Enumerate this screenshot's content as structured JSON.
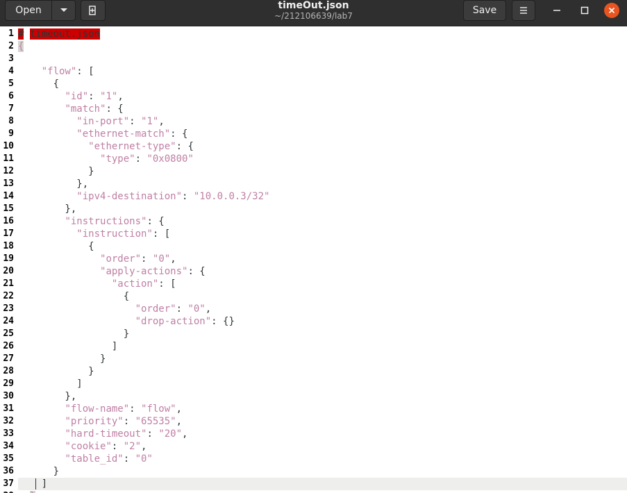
{
  "header": {
    "open_label": "Open",
    "title": "timeOut.json",
    "subtitle": "~/212106639/lab7",
    "save_label": "Save",
    "icons": {
      "open_menu": "chevron-down-icon",
      "new_tab": "new-document-icon",
      "menu": "hamburger-menu-icon",
      "minimize": "minimize-icon",
      "maximize": "maximize-icon",
      "close": "close-icon"
    },
    "colors": {
      "headerbar": "#2f2f2f",
      "close_button": "#e95420"
    }
  },
  "editor": {
    "current_line": 37,
    "colors": {
      "string": "#bf7fa4",
      "error_highlight": "#cc0000",
      "current_line_bg": "#eeeeec"
    },
    "lines": [
      [
        {
          "t": "#",
          "c": "err"
        },
        {
          "t": " ",
          "c": "punc"
        },
        {
          "t": "timeout.json",
          "c": "err"
        }
      ],
      [
        {
          "t": "{",
          "c": "box"
        }
      ],
      [],
      [
        {
          "t": "    ",
          "c": "punc"
        },
        {
          "t": "\"flow\"",
          "c": "str"
        },
        {
          "t": ": [",
          "c": "punc"
        }
      ],
      [
        {
          "t": "      {",
          "c": "punc"
        }
      ],
      [
        {
          "t": "        ",
          "c": "punc"
        },
        {
          "t": "\"id\"",
          "c": "str"
        },
        {
          "t": ": ",
          "c": "punc"
        },
        {
          "t": "\"1\"",
          "c": "str"
        },
        {
          "t": ",",
          "c": "punc"
        }
      ],
      [
        {
          "t": "        ",
          "c": "punc"
        },
        {
          "t": "\"match\"",
          "c": "str"
        },
        {
          "t": ": {",
          "c": "punc"
        }
      ],
      [
        {
          "t": "          ",
          "c": "punc"
        },
        {
          "t": "\"in-port\"",
          "c": "str"
        },
        {
          "t": ": ",
          "c": "punc"
        },
        {
          "t": "\"1\"",
          "c": "str"
        },
        {
          "t": ",",
          "c": "punc"
        }
      ],
      [
        {
          "t": "          ",
          "c": "punc"
        },
        {
          "t": "\"ethernet-match\"",
          "c": "str"
        },
        {
          "t": ": {",
          "c": "punc"
        }
      ],
      [
        {
          "t": "            ",
          "c": "punc"
        },
        {
          "t": "\"ethernet-type\"",
          "c": "str"
        },
        {
          "t": ": {",
          "c": "punc"
        }
      ],
      [
        {
          "t": "              ",
          "c": "punc"
        },
        {
          "t": "\"type\"",
          "c": "str"
        },
        {
          "t": ": ",
          "c": "punc"
        },
        {
          "t": "\"0x0800\"",
          "c": "str"
        }
      ],
      [
        {
          "t": "            }",
          "c": "punc"
        }
      ],
      [
        {
          "t": "          },",
          "c": "punc"
        }
      ],
      [
        {
          "t": "          ",
          "c": "punc"
        },
        {
          "t": "\"ipv4-destination\"",
          "c": "str"
        },
        {
          "t": ": ",
          "c": "punc"
        },
        {
          "t": "\"10.0.0.3/32\"",
          "c": "str"
        }
      ],
      [
        {
          "t": "        },",
          "c": "punc"
        }
      ],
      [
        {
          "t": "        ",
          "c": "punc"
        },
        {
          "t": "\"instructions\"",
          "c": "str"
        },
        {
          "t": ": {",
          "c": "punc"
        }
      ],
      [
        {
          "t": "          ",
          "c": "punc"
        },
        {
          "t": "\"instruction\"",
          "c": "str"
        },
        {
          "t": ": [",
          "c": "punc"
        }
      ],
      [
        {
          "t": "            {",
          "c": "punc"
        }
      ],
      [
        {
          "t": "              ",
          "c": "punc"
        },
        {
          "t": "\"order\"",
          "c": "str"
        },
        {
          "t": ": ",
          "c": "punc"
        },
        {
          "t": "\"0\"",
          "c": "str"
        },
        {
          "t": ",",
          "c": "punc"
        }
      ],
      [
        {
          "t": "              ",
          "c": "punc"
        },
        {
          "t": "\"apply-actions\"",
          "c": "str"
        },
        {
          "t": ": {",
          "c": "punc"
        }
      ],
      [
        {
          "t": "                ",
          "c": "punc"
        },
        {
          "t": "\"action\"",
          "c": "str"
        },
        {
          "t": ": [",
          "c": "punc"
        }
      ],
      [
        {
          "t": "                  {",
          "c": "punc"
        }
      ],
      [
        {
          "t": "                    ",
          "c": "punc"
        },
        {
          "t": "\"order\"",
          "c": "str"
        },
        {
          "t": ": ",
          "c": "punc"
        },
        {
          "t": "\"0\"",
          "c": "str"
        },
        {
          "t": ",",
          "c": "punc"
        }
      ],
      [
        {
          "t": "                    ",
          "c": "punc"
        },
        {
          "t": "\"drop-action\"",
          "c": "str"
        },
        {
          "t": ": {}",
          "c": "punc"
        }
      ],
      [
        {
          "t": "                  }",
          "c": "punc"
        }
      ],
      [
        {
          "t": "                ]",
          "c": "punc"
        }
      ],
      [
        {
          "t": "              }",
          "c": "punc"
        }
      ],
      [
        {
          "t": "            }",
          "c": "punc"
        }
      ],
      [
        {
          "t": "          ]",
          "c": "punc"
        }
      ],
      [
        {
          "t": "        },",
          "c": "punc"
        }
      ],
      [
        {
          "t": "        ",
          "c": "punc"
        },
        {
          "t": "\"flow-name\"",
          "c": "str"
        },
        {
          "t": ": ",
          "c": "punc"
        },
        {
          "t": "\"flow\"",
          "c": "str"
        },
        {
          "t": ",",
          "c": "punc"
        }
      ],
      [
        {
          "t": "        ",
          "c": "punc"
        },
        {
          "t": "\"priority\"",
          "c": "str"
        },
        {
          "t": ": ",
          "c": "punc"
        },
        {
          "t": "\"65535\"",
          "c": "str"
        },
        {
          "t": ",",
          "c": "punc"
        }
      ],
      [
        {
          "t": "        ",
          "c": "punc"
        },
        {
          "t": "\"hard-timeout\"",
          "c": "str"
        },
        {
          "t": ": ",
          "c": "punc"
        },
        {
          "t": "\"20\"",
          "c": "str"
        },
        {
          "t": ",",
          "c": "punc"
        }
      ],
      [
        {
          "t": "        ",
          "c": "punc"
        },
        {
          "t": "\"cookie\"",
          "c": "str"
        },
        {
          "t": ": ",
          "c": "punc"
        },
        {
          "t": "\"2\"",
          "c": "str"
        },
        {
          "t": ",",
          "c": "punc"
        }
      ],
      [
        {
          "t": "        ",
          "c": "punc"
        },
        {
          "t": "\"table_id\"",
          "c": "str"
        },
        {
          "t": ": ",
          "c": "punc"
        },
        {
          "t": "\"0\"",
          "c": "str"
        }
      ],
      [
        {
          "t": "      }",
          "c": "punc"
        }
      ],
      [
        {
          "t": "    ]",
          "c": "punc"
        }
      ],
      [
        {
          "t": "  ",
          "c": "punc"
        },
        {
          "t": "}",
          "c": "box"
        }
      ]
    ]
  }
}
